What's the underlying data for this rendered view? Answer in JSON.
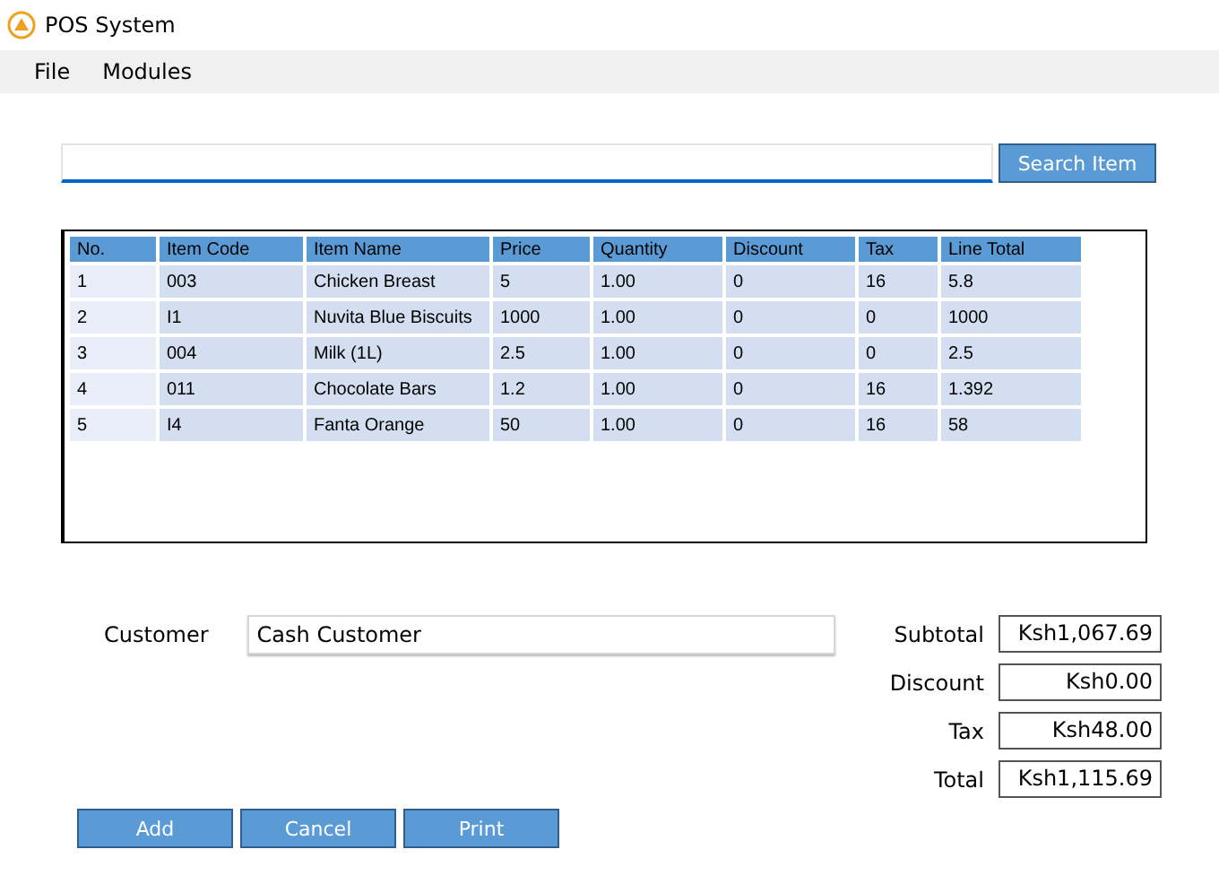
{
  "window": {
    "title": "POS System"
  },
  "menu": [
    "File",
    "Modules"
  ],
  "search": {
    "button": "Search Item"
  },
  "table": {
    "columns": [
      "No.",
      "Item Code",
      "Item Name",
      "Price",
      "Quantity",
      "Discount",
      "Tax",
      "Line Total"
    ],
    "rows": [
      [
        "1",
        "003",
        "Chicken Breast",
        "5",
        "1.00",
        "0",
        "16",
        "5.8"
      ],
      [
        "2",
        "I1",
        "Nuvita Blue Biscuits",
        "1000",
        "1.00",
        "0",
        "0",
        "1000"
      ],
      [
        "3",
        "004",
        "Milk (1L)",
        "2.5",
        "1.00",
        "0",
        "0",
        "2.5"
      ],
      [
        "4",
        "011",
        "Chocolate Bars",
        "1.2",
        "1.00",
        "0",
        "16",
        "1.392"
      ],
      [
        "5",
        "I4",
        "Fanta Orange",
        "50",
        "1.00",
        "0",
        "16",
        "58"
      ]
    ]
  },
  "customer": {
    "label": "Customer",
    "value": "Cash Customer"
  },
  "totals": [
    {
      "label": "Subtotal",
      "value": "Ksh1,067.69"
    },
    {
      "label": "Discount",
      "value": "Ksh0.00"
    },
    {
      "label": "Tax",
      "value": "Ksh48.00"
    },
    {
      "label": "Total",
      "value": "Ksh1,115.69"
    }
  ],
  "buttons": [
    "Add",
    "Cancel",
    "Print"
  ]
}
